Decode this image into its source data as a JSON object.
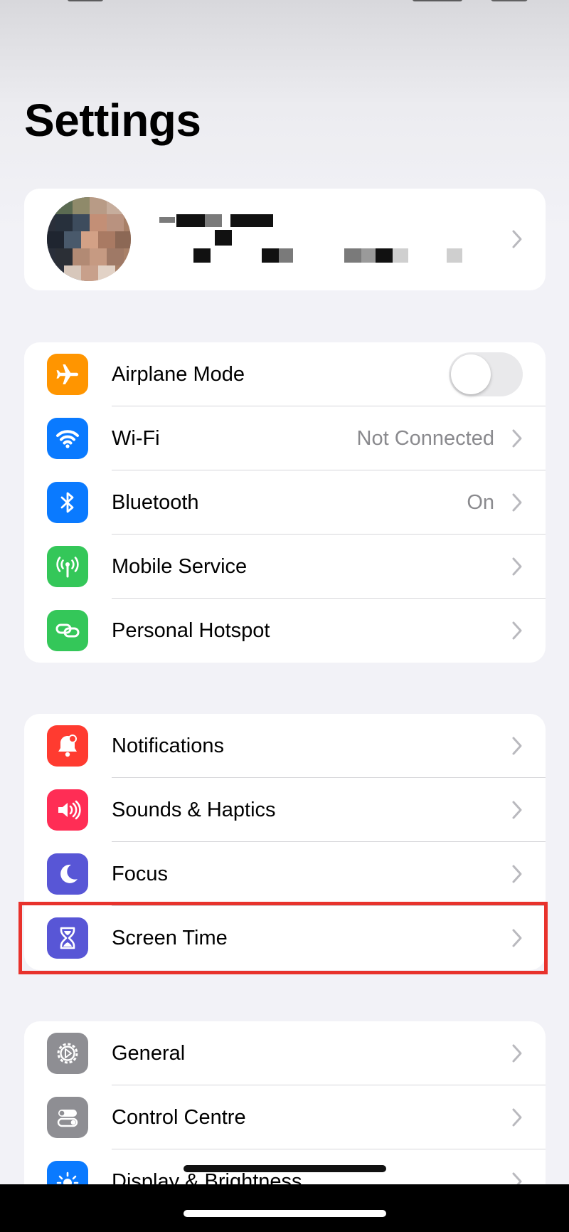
{
  "page_title": "Settings",
  "profile": {
    "name": "",
    "subtitle": ""
  },
  "groups": [
    {
      "items": [
        {
          "label": "Airplane Mode",
          "icon": "airplane-icon",
          "color": "#ff9500",
          "control": "toggle",
          "toggle_on": false
        },
        {
          "label": "Wi-Fi",
          "value": "Not Connected",
          "icon": "wifi-icon",
          "color": "#0a7aff"
        },
        {
          "label": "Bluetooth",
          "value": "On",
          "icon": "bluetooth-icon",
          "color": "#0a7aff"
        },
        {
          "label": "Mobile Service",
          "icon": "antenna-icon",
          "color": "#34c759"
        },
        {
          "label": "Personal Hotspot",
          "icon": "hotspot-link-icon",
          "color": "#34c759"
        }
      ]
    },
    {
      "items": [
        {
          "label": "Notifications",
          "icon": "bell-icon",
          "color": "#ff3b30"
        },
        {
          "label": "Sounds & Haptics",
          "icon": "speaker-icon",
          "color": "#ff2d55"
        },
        {
          "label": "Focus",
          "icon": "moon-icon",
          "color": "#5856d6"
        },
        {
          "label": "Screen Time",
          "icon": "hourglass-icon",
          "color": "#5856d6",
          "highlighted": true
        }
      ]
    },
    {
      "items": [
        {
          "label": "General",
          "icon": "gear-icon",
          "color": "#8e8e93"
        },
        {
          "label": "Control Centre",
          "icon": "switches-icon",
          "color": "#8e8e93"
        },
        {
          "label": "Display & Brightness",
          "icon": "sun-icon",
          "color": "#0a7aff"
        }
      ]
    }
  ],
  "colors": {
    "highlight_border": "#e8322c",
    "background": "#f2f2f7",
    "secondary_text": "#8a8a8e"
  }
}
